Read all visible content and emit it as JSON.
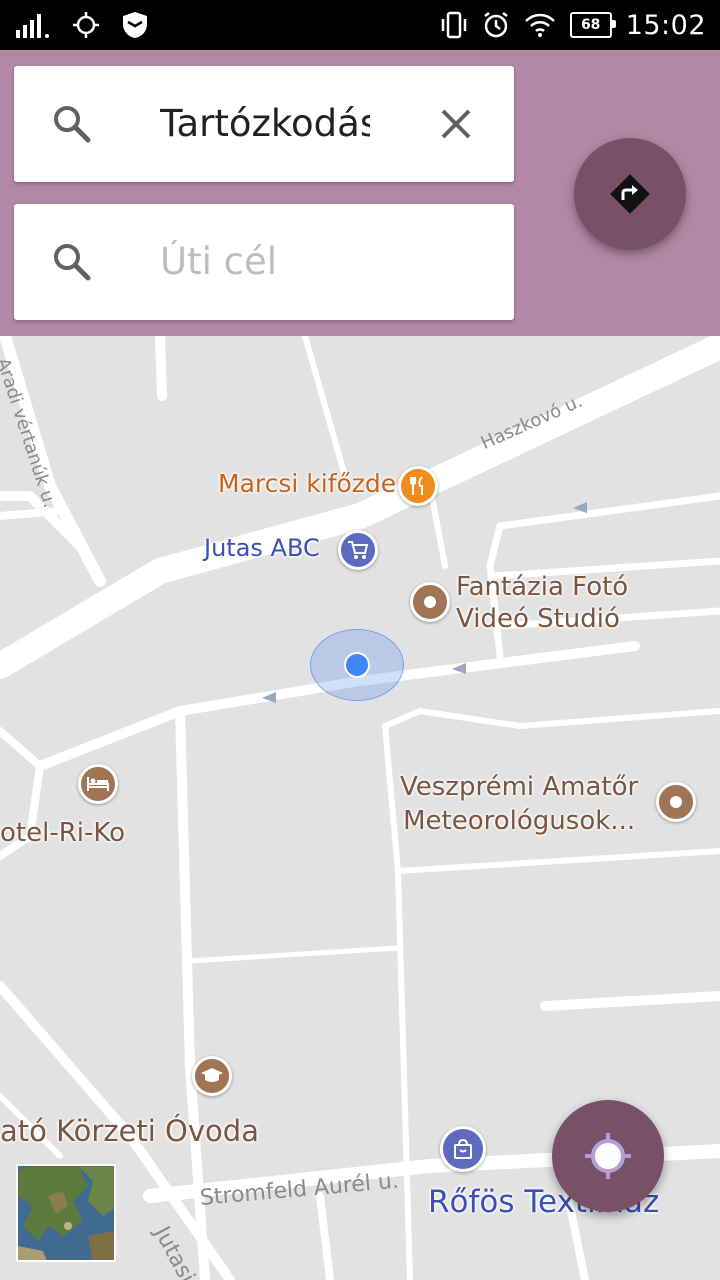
{
  "status_bar": {
    "time": "15:02",
    "battery_level": "68",
    "icons": [
      "signal-icon",
      "gps-icon",
      "shield-icon",
      "vibrate-icon",
      "alarm-icon",
      "wifi-icon",
      "battery-icon"
    ]
  },
  "search": {
    "origin_value": "Tartózkodás",
    "destination_placeholder": "Úti cél"
  },
  "map": {
    "pois": {
      "marcsi": "Marcsi kifőzde",
      "jutas": "Jutas ABC",
      "fantazia_line1": "Fantázia Fotó",
      "fantazia_line2": "Videó Studió",
      "hotel": "otel-Ri-Ko",
      "veszpremi_line1": "Veszprémi Amatőr",
      "veszpremi_line2": "Meteorológusok...",
      "ovoda": "ató Körzeti Óvoda",
      "rofos": "Rőfös Textilház"
    },
    "streets": {
      "aradi": "Aradi vértanúk u.",
      "haszkovo": "Haszkovó u.",
      "stromfeld": "Stromfeld Aurél u.",
      "jutasi": "Jutasi út"
    }
  },
  "colors": {
    "header_bg": "#b388a6",
    "fab_bg": "#7a5067",
    "location_dot": "#4285f4",
    "poi_brown": "#a07556",
    "poi_orange": "#f08c1e",
    "poi_blue": "#5c6bc0"
  }
}
